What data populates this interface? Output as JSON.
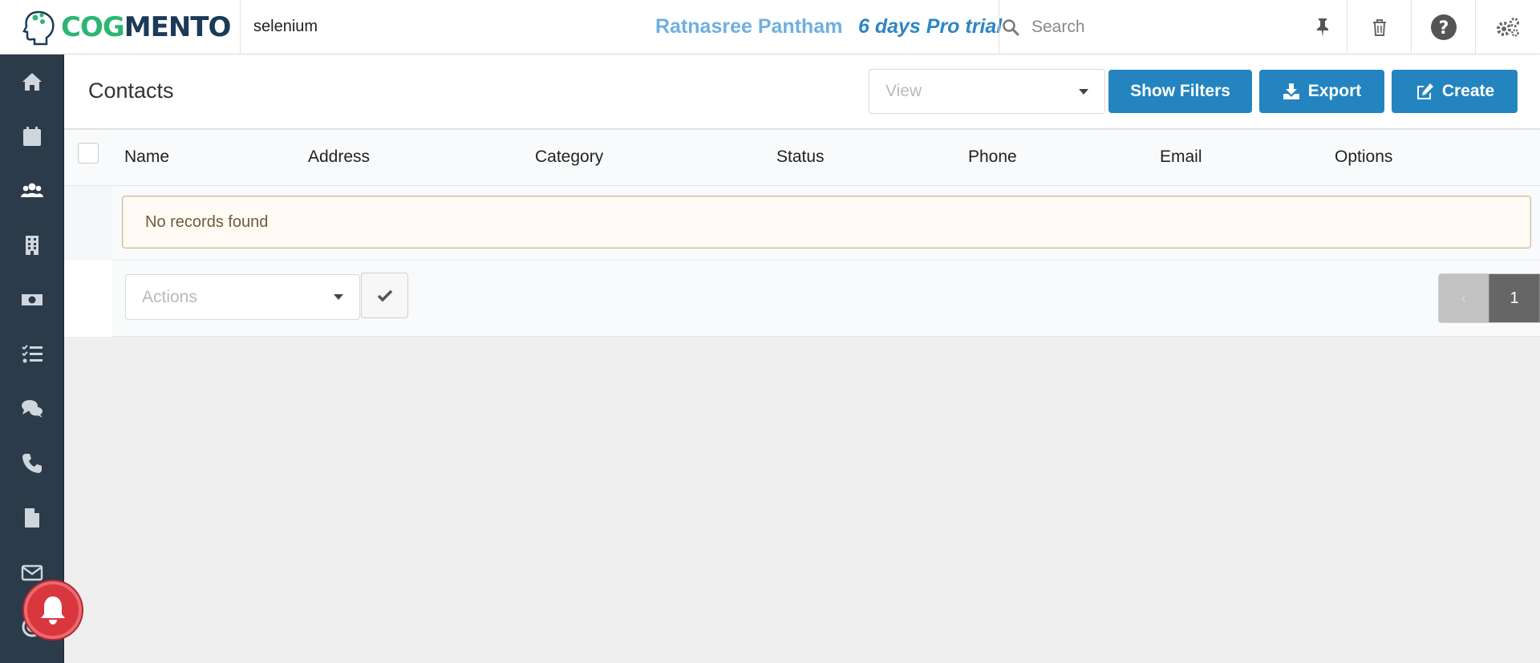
{
  "topbar": {
    "logo_text_a": "COG",
    "logo_text_b": "MENTO",
    "account": "selenium",
    "user_name": "Ratnasree Pantham",
    "trial": "6 days Pro trial",
    "search_placeholder": "Search",
    "icons": [
      "search-icon",
      "pin-icon",
      "trash-icon",
      "help-icon",
      "settings-icon"
    ]
  },
  "sidebar": {
    "items": [
      {
        "icon": "home-icon"
      },
      {
        "icon": "calendar-icon"
      },
      {
        "icon": "contacts-icon"
      },
      {
        "icon": "company-icon"
      },
      {
        "icon": "deals-icon"
      },
      {
        "icon": "tasks-icon"
      },
      {
        "icon": "cases-icon"
      },
      {
        "icon": "calls-icon"
      },
      {
        "icon": "documents-icon"
      },
      {
        "icon": "email-icon"
      },
      {
        "icon": "campaigns-icon"
      }
    ]
  },
  "header": {
    "title": "Contacts",
    "view_placeholder": "View",
    "show_filters": "Show Filters",
    "export": "Export",
    "create": "Create"
  },
  "table": {
    "columns": [
      "Name",
      "Address",
      "Category",
      "Status",
      "Phone",
      "Email",
      "Options"
    ],
    "empty_message": "No records found"
  },
  "footer": {
    "actions_placeholder": "Actions",
    "pagination": {
      "prev": "‹",
      "current": "1",
      "next": "›"
    }
  },
  "colors": {
    "brand_green": "#2cb673",
    "brand_navy": "#1b3a58",
    "primary_button": "#2384bf",
    "sidebar": "#2b3b4a",
    "notification": "#d9363e"
  }
}
